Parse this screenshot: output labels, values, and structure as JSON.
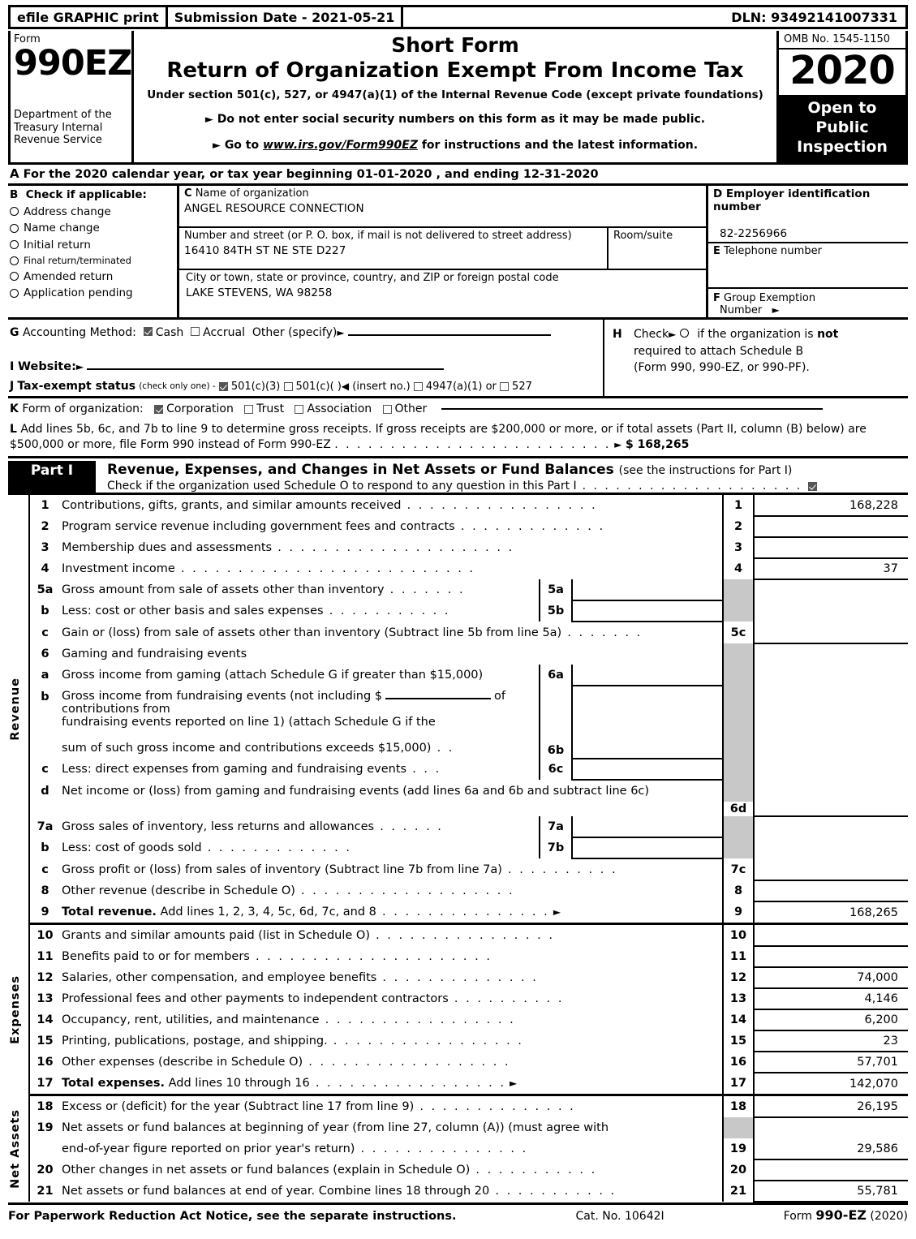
{
  "efile": {
    "graphic_print": "efile GRAPHIC print",
    "submission_date": "Submission Date - 2021-05-21",
    "dln": "DLN: 93492141007331"
  },
  "header": {
    "form_label": "Form",
    "form_number": "990EZ",
    "department": "Department of the Treasury Internal Revenue Service",
    "short_form": "Short Form",
    "title": "Return of Organization Exempt From Income Tax",
    "subtitle": "Under section 501(c), 527, or 4947(a)(1) of the Internal Revenue Code (except private foundations)",
    "bullet1": "Do not enter social security numbers on this form as it may be made public.",
    "bullet2_pre": "Go to ",
    "bullet2_link": "www.irs.gov/Form990EZ",
    "bullet2_post": " for instructions and the latest information.",
    "omb": "OMB No. 1545-1150",
    "year": "2020",
    "open_to_public": "Open to Public Inspection"
  },
  "line_a": {
    "letter": "A",
    "text": "For the 2020 calendar year, or tax year beginning 01-01-2020 , and ending 12-31-2020"
  },
  "section_b": {
    "letter": "B",
    "title": "Check if applicable:",
    "items": [
      {
        "label": "Address change",
        "checked": false
      },
      {
        "label": "Name change",
        "checked": false
      },
      {
        "label": "Initial return",
        "checked": false
      },
      {
        "label": "Final return/terminated",
        "checked": false
      },
      {
        "label": "Amended return",
        "checked": false
      },
      {
        "label": "Application pending",
        "checked": false
      }
    ]
  },
  "section_c": {
    "letter": "C",
    "name_label": "Name of organization",
    "name_value": "ANGEL RESOURCE CONNECTION",
    "street_label": "Number and street (or P. O. box, if mail is not delivered to street address)",
    "street_value": "16410 84TH ST NE STE D227",
    "room_label": "Room/suite",
    "room_value": "",
    "city_label": "City or town, state or province, country, and ZIP or foreign postal code",
    "city_value": "LAKE STEVENS, WA  98258"
  },
  "section_d": {
    "letter": "D",
    "ein_label": "Employer identification number",
    "ein_value": "82-2256966",
    "tel_letter": "E",
    "tel_label": "Telephone number",
    "tel_value": "",
    "grp_letter": "F",
    "grp_label": "Group Exemption",
    "grp_label2": "Number",
    "grp_value": ""
  },
  "section_g": {
    "letter": "G",
    "label": "Accounting Method:",
    "cash": "Cash",
    "cash_checked": true,
    "accrual": "Accrual",
    "accrual_checked": false,
    "other": "Other (specify)",
    "other_value": ""
  },
  "section_h": {
    "letter": "H",
    "line1_pre": "Check",
    "line1_post": "if the organization is",
    "line1_bold": "not",
    "line2": "required to attach Schedule B",
    "line3": "(Form 990, 990-EZ, or 990-PF).",
    "checked": false
  },
  "section_i": {
    "letter": "I",
    "label": "Website:",
    "value": ""
  },
  "section_j": {
    "letter": "J",
    "label": "Tax-exempt status",
    "note": "(check only one) -",
    "options": [
      {
        "label": "501(c)(3)",
        "checked": true
      },
      {
        "label": "501(c)(   )",
        "checked": false
      },
      {
        "label": "4947(a)(1) or",
        "checked": false
      },
      {
        "label": "527",
        "checked": false
      }
    ],
    "insert_no": "(insert no.)"
  },
  "section_k": {
    "letter": "K",
    "label": "Form of organization:",
    "options": [
      {
        "label": "Corporation",
        "checked": true
      },
      {
        "label": "Trust",
        "checked": false
      },
      {
        "label": "Association",
        "checked": false
      },
      {
        "label": "Other",
        "checked": false
      }
    ]
  },
  "section_l": {
    "letter": "L",
    "text1": "Add lines 5b, 6c, and 7b to line 9 to determine gross receipts. If gross receipts are $200,000 or more, or if total assets (Part II, column (B) below) are",
    "text2": "$500,000 or more, file Form 990 instead of Form 990-EZ",
    "amount": "$ 168,265"
  },
  "part1": {
    "label": "Part I",
    "title": "Revenue, Expenses, and Changes in Net Assets or Fund Balances",
    "title_note": "(see the instructions for Part I)",
    "schedule_o": "Check if the organization used Schedule O to respond to any question in this Part I",
    "schedule_o_checked": true
  },
  "side_labels": {
    "revenue": "Revenue",
    "expenses": "Expenses",
    "net_assets": "Net Assets"
  },
  "revenue_lines": [
    {
      "num": "1",
      "desc": "Contributions, gifts, grants, and similar amounts received",
      "code": "1",
      "amount": "168,228"
    },
    {
      "num": "2",
      "desc": "Program service revenue including government fees and contracts",
      "code": "2",
      "amount": ""
    },
    {
      "num": "3",
      "desc": "Membership dues and assessments",
      "code": "3",
      "amount": ""
    },
    {
      "num": "4",
      "desc": "Investment income",
      "code": "4",
      "amount": "37"
    },
    {
      "num": "5a",
      "desc": "Gross amount from sale of assets other than inventory",
      "inner_code": "5a",
      "inner_value": ""
    },
    {
      "num": "b",
      "desc": "Less: cost or other basis and sales expenses",
      "inner_code": "5b",
      "inner_value": ""
    },
    {
      "num": "c",
      "desc": "Gain or (loss) from sale of assets other than inventory (Subtract line 5b from line 5a)",
      "code": "5c",
      "amount": ""
    },
    {
      "num": "6",
      "desc": "Gaming and fundraising events"
    },
    {
      "num": "a",
      "desc": "Gross income from gaming (attach Schedule G if greater than $15,000)",
      "inner_code": "6a",
      "inner_value": ""
    },
    {
      "num": "b",
      "desc_1": "Gross income from fundraising events (not including $",
      "desc_2": "of contributions from",
      "desc_3": "fundraising events reported on line 1) (attach Schedule G if the",
      "desc_4": "sum of such gross income and contributions exceeds $15,000)",
      "inner_code": "6b",
      "inner_value": ""
    },
    {
      "num": "c",
      "desc": "Less: direct expenses from gaming and fundraising events",
      "inner_code": "6c",
      "inner_value": ""
    },
    {
      "num": "d",
      "desc": "Net income or (loss) from gaming and fundraising events (add lines 6a and 6b and subtract line 6c)",
      "code": "6d",
      "amount": ""
    },
    {
      "num": "7a",
      "desc": "Gross sales of inventory, less returns and allowances",
      "inner_code": "7a",
      "inner_value": ""
    },
    {
      "num": "b",
      "desc": "Less: cost of goods sold",
      "inner_code": "7b",
      "inner_value": ""
    },
    {
      "num": "c",
      "desc": "Gross profit or (loss) from sales of inventory (Subtract line 7b from line 7a)",
      "code": "7c",
      "amount": ""
    },
    {
      "num": "8",
      "desc": "Other revenue (describe in Schedule O)",
      "code": "8",
      "amount": ""
    },
    {
      "num": "9",
      "desc_bold": "Total revenue.",
      "desc": " Add lines 1, 2, 3, 4, 5c, 6d, 7c, and 8",
      "code": "9",
      "amount": "168,265"
    }
  ],
  "expense_lines": [
    {
      "num": "10",
      "desc": "Grants and similar amounts paid (list in Schedule O)",
      "code": "10",
      "amount": ""
    },
    {
      "num": "11",
      "desc": "Benefits paid to or for members",
      "code": "11",
      "amount": ""
    },
    {
      "num": "12",
      "desc": "Salaries, other compensation, and employee benefits",
      "code": "12",
      "amount": "74,000"
    },
    {
      "num": "13",
      "desc": "Professional fees and other payments to independent contractors",
      "code": "13",
      "amount": "4,146"
    },
    {
      "num": "14",
      "desc": "Occupancy, rent, utilities, and maintenance",
      "code": "14",
      "amount": "6,200"
    },
    {
      "num": "15",
      "desc": "Printing, publications, postage, and shipping.",
      "code": "15",
      "amount": "23"
    },
    {
      "num": "16",
      "desc": "Other expenses (describe in Schedule O)",
      "code": "16",
      "amount": "57,701"
    },
    {
      "num": "17",
      "desc_bold": "Total expenses.",
      "desc": " Add lines 10 through 16",
      "code": "17",
      "amount": "142,070"
    }
  ],
  "netasset_lines": [
    {
      "num": "18",
      "desc": "Excess or (deficit) for the year (Subtract line 17 from line 9)",
      "code": "18",
      "amount": "26,195"
    },
    {
      "num": "19",
      "desc_1": "Net assets or fund balances at beginning of year (from line 27, column (A)) (must agree with",
      "desc_2": "end-of-year figure reported on prior year's return)",
      "code": "19",
      "amount": "29,586"
    },
    {
      "num": "20",
      "desc": "Other changes in net assets or fund balances (explain in Schedule O)",
      "code": "20",
      "amount": ""
    },
    {
      "num": "21",
      "desc": "Net assets or fund balances at end of year. Combine lines 18 through 20",
      "code": "21",
      "amount": "55,781"
    }
  ],
  "footer": {
    "notice": "For Paperwork Reduction Act Notice, see the separate instructions.",
    "cat": "Cat. No. 10642I",
    "form_pre": "Form ",
    "form_bold": "990-EZ",
    "form_year": " (2020)"
  }
}
